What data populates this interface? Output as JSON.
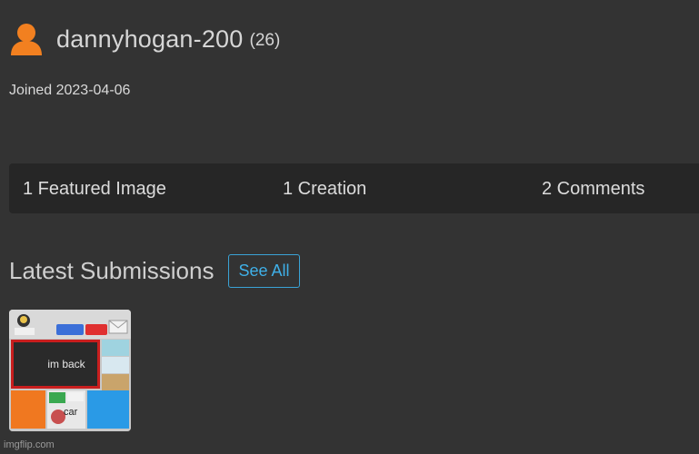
{
  "profile": {
    "username": "dannyhogan-200",
    "points": "(26)",
    "joined": "Joined 2023-04-06",
    "icon": "user-icon",
    "icon_color": "#f28020"
  },
  "stats": {
    "featured": "1 Featured Image",
    "creations": "1 Creation",
    "comments": "2 Comments"
  },
  "latest": {
    "heading": "Latest Submissions",
    "see_all": "See All",
    "accent_color": "#3fb0e8",
    "thumbnail": {
      "caption": "im back",
      "car_text": "car"
    }
  },
  "watermark": "imgflip.com"
}
